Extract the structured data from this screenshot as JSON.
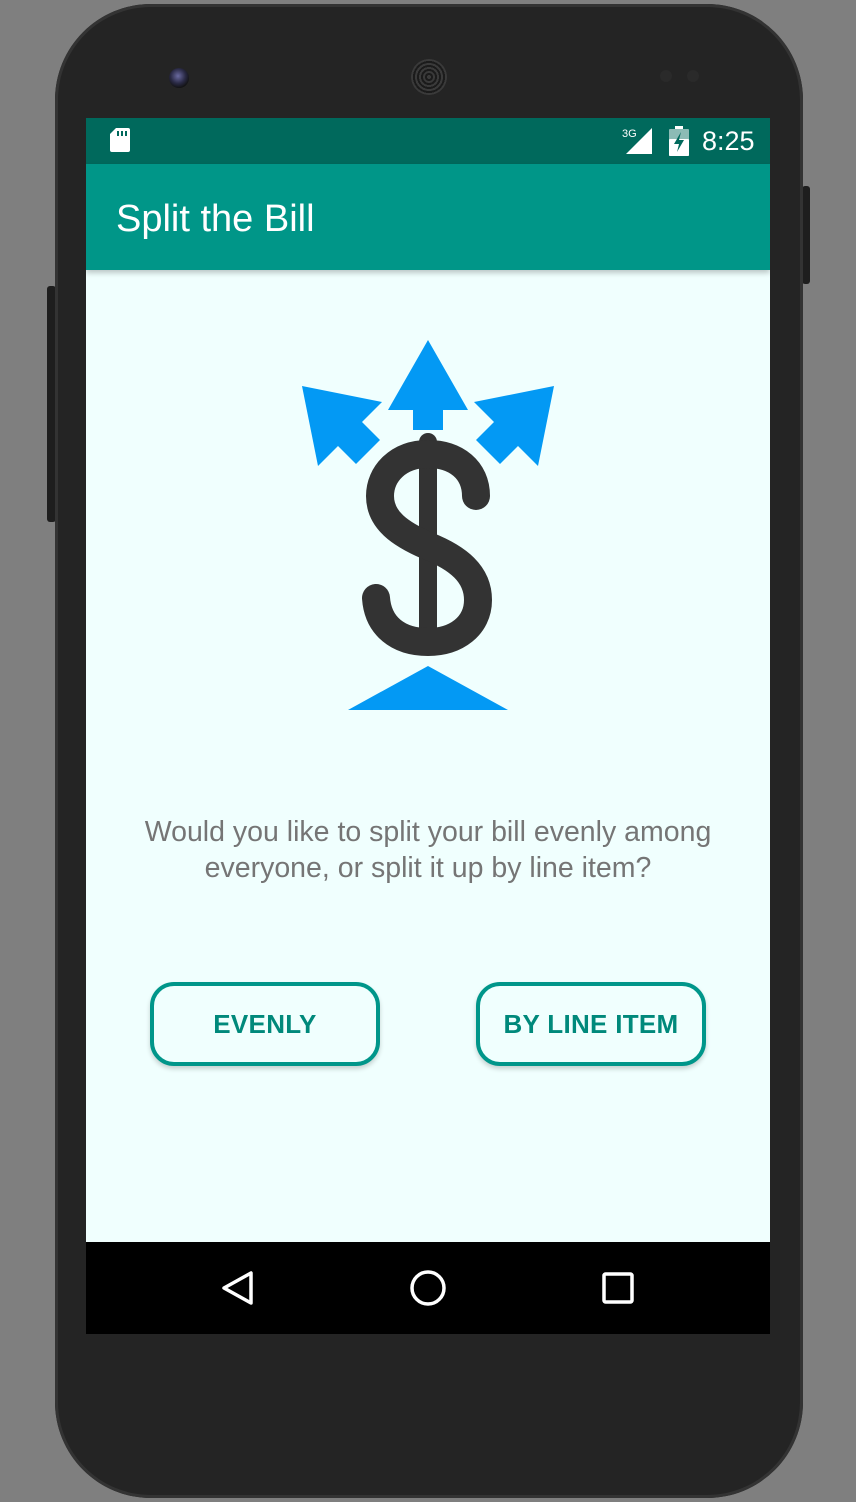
{
  "status_bar": {
    "time": "8:25",
    "network_label": "3G",
    "icons": [
      "sd-card-icon",
      "signal-icon",
      "battery-charging-icon"
    ]
  },
  "app_bar": {
    "title": "Split the Bill"
  },
  "main": {
    "logo_icon": "split-dollar-icon",
    "question": "Would you like to split your bill evenly among everyone, or split it up by line item?",
    "buttons": {
      "evenly": "EVENLY",
      "by_line_item": "BY LINE ITEM"
    }
  },
  "navigation": {
    "icons": [
      "back-icon",
      "home-icon",
      "recents-icon"
    ]
  },
  "colors": {
    "status_bar": "#00695c",
    "app_bar": "#009688",
    "screen_background": "#f0fffe",
    "accent": "#00897b",
    "logo_arrows": "#0399f4",
    "logo_dollar": "#333333",
    "question_text": "#757575"
  }
}
